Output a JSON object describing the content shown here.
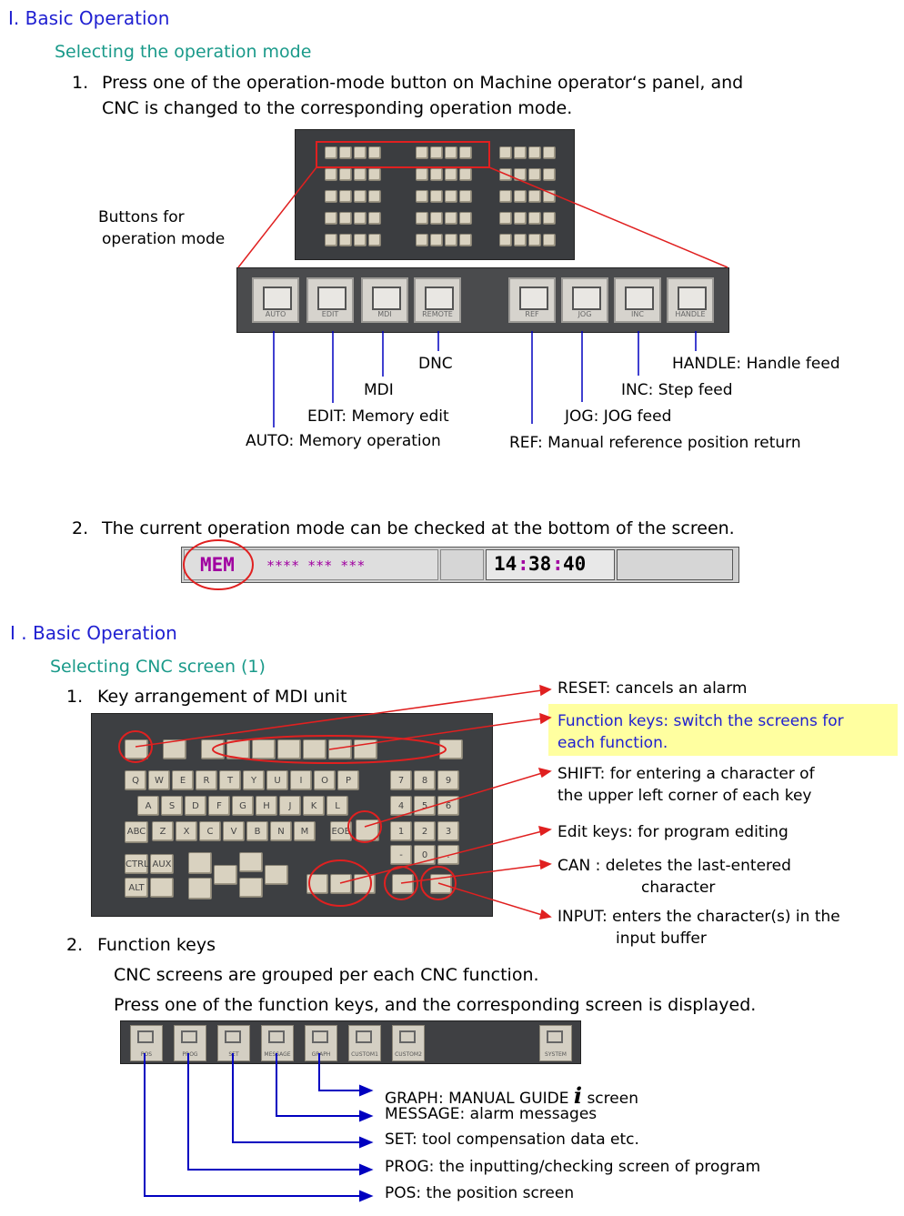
{
  "section1": {
    "heading": "I. Basic Operation",
    "subheading": "Selecting the operation mode",
    "step1_num": "1.",
    "step1_line1": "Press one of the operation-mode button on Machine operator‘s panel, and",
    "step1_line2": "CNC is changed to the corresponding operation mode.",
    "buttons_label_line1": "Buttons for",
    "buttons_label_line2": "operation mode",
    "mode_buttons": [
      "AUTO",
      "EDIT",
      "MDI",
      "REMOTE",
      "REF",
      "JOG",
      "INC",
      "HANDLE"
    ],
    "callouts": {
      "dnc": "DNC",
      "mdi": "MDI",
      "edit": "EDIT: Memory edit",
      "auto": "AUTO: Memory operation",
      "handle": "HANDLE: Handle feed",
      "inc": "INC: Step feed",
      "jog": "JOG: JOG feed",
      "ref": "REF: Manual reference position return"
    },
    "step2_num": "2.",
    "step2_text": "The current operation mode can be checked at the bottom of the screen.",
    "status_bar": {
      "mode": "MEM",
      "fields": "**** ***  ***",
      "time_h": "14",
      "time_m": "38",
      "time_s": "40"
    }
  },
  "section2": {
    "heading": "I . Basic Operation",
    "subheading": "Selecting CNC screen (1)",
    "step1_num": "1.",
    "step1_text": "Key arrangement of MDI unit",
    "callouts": {
      "reset": "RESET: cancels an alarm",
      "function_line1": "Function keys: switch the screens for",
      "function_line2": "each function.",
      "shift_line1": "SHIFT: for entering a character of",
      "shift_line2": "the upper left corner of each key",
      "edit_keys": "Edit keys: for program editing",
      "can_line1": "CAN : deletes the last-entered",
      "can_line2": "character",
      "input_line1": "INPUT: enters the character(s) in the",
      "input_line2": "input buffer"
    },
    "mdi_keys": {
      "row1": [
        "Q",
        "W",
        "E",
        "R",
        "T",
        "Y",
        "U",
        "I",
        "O",
        "P"
      ],
      "row2": [
        "A",
        "S",
        "D",
        "F",
        "G",
        "H",
        "J",
        "K",
        "L"
      ],
      "row3": [
        "Z",
        "X",
        "C",
        "V",
        "B",
        "N",
        "M"
      ],
      "row3_left": "ABC",
      "row3_right": "EOB",
      "num1": [
        "7",
        "8",
        "9"
      ],
      "num2": [
        "4",
        "5",
        "6"
      ],
      "num3": [
        "1",
        "2",
        "3"
      ],
      "num4": [
        "-",
        "0",
        "."
      ],
      "ctrl": "CTRL",
      "aux": "AUX",
      "alt": "ALT"
    },
    "step2_num": "2.",
    "step2_text": "Function keys",
    "para1": "CNC screens are grouped per each CNC function.",
    "para2": "Press one of the function keys, and the corresponding screen is displayed.",
    "fkey_labels": [
      "POS",
      "PROG",
      "SET",
      "MESSAGE",
      "GRAPH",
      "CUSTOM1",
      "CUSTOM2",
      "SYSTEM"
    ],
    "fkey_callouts": {
      "graph_a": "GRAPH:  MANUAL GUIDE ",
      "graph_i": "i",
      "graph_b": " screen",
      "message": "MESSAGE:  alarm messages",
      "set": "SET:  tool compensation data etc.",
      "prog": "PROG:  the inputting/checking screen of program",
      "pos": "POS:  the position screen"
    }
  },
  "colors": {
    "heading": "#1f1fd1",
    "subheading": "#1a9a8a",
    "callout_red": "#e02020",
    "callout_blue": "#0000c0",
    "mode_text": "#a000a0",
    "highlight": "#ffffa0"
  }
}
